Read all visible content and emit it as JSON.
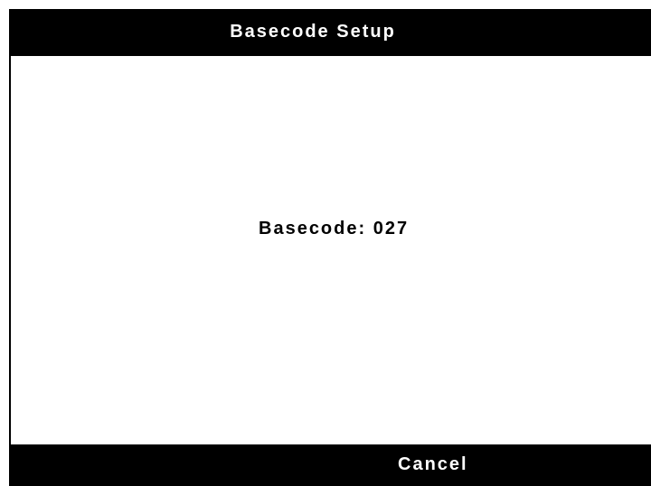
{
  "header": {
    "title": "Basecode Setup"
  },
  "main": {
    "basecode_label": "Basecode:",
    "basecode_value": "027"
  },
  "footer": {
    "cancel_label": "Cancel"
  },
  "colors": {
    "bar_background": "#000000",
    "bar_text": "#ffffff",
    "panel_background": "#ffffff",
    "panel_text": "#000000"
  }
}
